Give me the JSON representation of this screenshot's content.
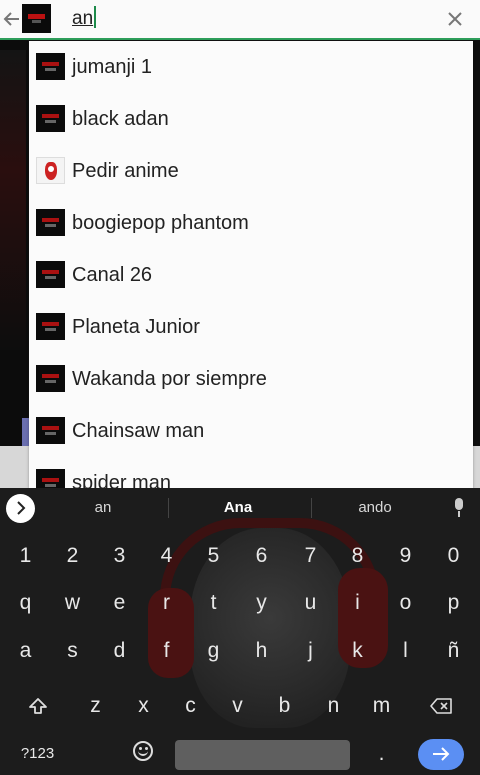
{
  "search": {
    "value": "an",
    "back_icon": "arrow-left-icon",
    "clear_icon": "close-icon",
    "accent_color": "#2e9e5b"
  },
  "suggestions": [
    {
      "label": "jumanji 1",
      "icon": "channel-logo"
    },
    {
      "label": "black adan",
      "icon": "channel-logo"
    },
    {
      "label": "Pedir anime",
      "icon": "anime-logo"
    },
    {
      "label": "boogiepop phantom",
      "icon": "channel-logo"
    },
    {
      "label": "Canal 26",
      "icon": "channel-logo"
    },
    {
      "label": "Planeta Junior",
      "icon": "channel-logo"
    },
    {
      "label": "Wakanda por siempre",
      "icon": "channel-logo"
    },
    {
      "label": "Chainsaw man",
      "icon": "channel-logo"
    },
    {
      "label": "spider man",
      "icon": "channel-logo"
    }
  ],
  "keyboard": {
    "suggestions": [
      "an",
      "Ana",
      "ando"
    ],
    "numbers": [
      "1",
      "2",
      "3",
      "4",
      "5",
      "6",
      "7",
      "8",
      "9",
      "0"
    ],
    "row1": [
      "q",
      "w",
      "e",
      "r",
      "t",
      "y",
      "u",
      "i",
      "o",
      "p"
    ],
    "row2": [
      "a",
      "s",
      "d",
      "f",
      "g",
      "h",
      "j",
      "k",
      "l",
      "ñ"
    ],
    "row3": [
      "z",
      "x",
      "c",
      "v",
      "b",
      "n",
      "m"
    ],
    "symbols_label": "?123",
    "period_label": ".",
    "enter_color": "#5b8ff3"
  }
}
